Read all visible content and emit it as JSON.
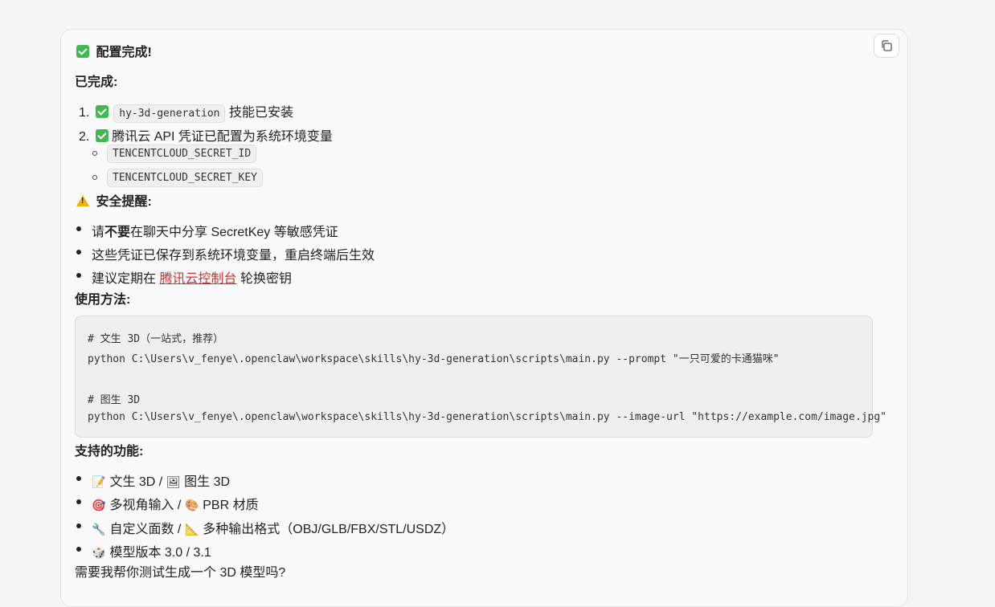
{
  "header": {
    "title": "配置完成!"
  },
  "done_section": {
    "title": "已完成:",
    "item1_code": "hy-3d-generation",
    "item1_text": "技能已安装",
    "item2_text": "腾讯云 API 凭证已配置为系统环境变量",
    "sub_items": [
      "TENCENTCLOUD_SECRET_ID",
      "TENCENTCLOUD_SECRET_KEY"
    ]
  },
  "security": {
    "title": "安全提醒:",
    "item1_prefix": "请",
    "item1_bold": "不要",
    "item1_suffix": "在聊天中分享 SecretKey 等敏感凭证",
    "item2": "这些凭证已保存到系统环境变量，重启终端后生效",
    "item3_prefix": "建议定期在",
    "item3_link": "腾讯云控制台",
    "item3_suffix": "轮换密钥"
  },
  "usage": {
    "title": "使用方法:",
    "code_lines": [
      "# 文生 3D（一站式，推荐）",
      "python C:\\Users\\v_fenye\\.openclaw\\workspace\\skills\\hy-3d-generation\\scripts\\main.py --prompt \"一只可爱的卡通猫咪\"",
      "# 图生 3D",
      "python C:\\Users\\v_fenye\\.openclaw\\workspace\\skills\\hy-3d-generation\\scripts\\main.py --image-url \"https://example.com/image.jpg\""
    ]
  },
  "features": {
    "title": "支持的功能:",
    "items": [
      {
        "icon": "📝",
        "text": "文生 3D / ",
        "icon2": "🖼",
        "text2": "图生 3D"
      },
      {
        "icon": "🎯",
        "text": "多视角输入 / ",
        "icon2": "🎨",
        "text2": "PBR 材质"
      },
      {
        "icon": "🔧",
        "text": "自定义面数 / ",
        "icon2": "📐",
        "text2": "多种输出格式（OBJ/GLB/FBX/STL/USDZ）"
      },
      {
        "icon": "🎲",
        "text": "模型版本 3.0 / 3.1",
        "icon2": "",
        "text2": ""
      }
    ]
  },
  "closing": "需要我帮你测试生成一个 3D 模型吗?"
}
